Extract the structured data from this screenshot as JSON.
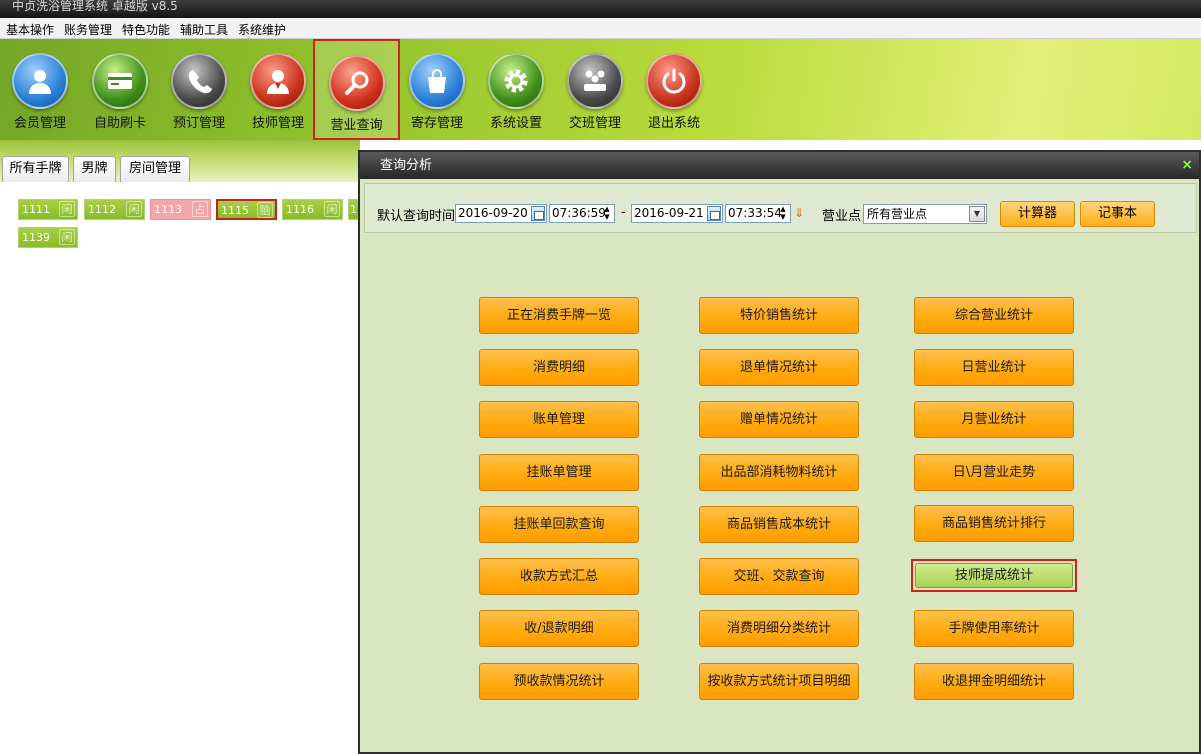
{
  "window": {
    "title": "中贞洗浴管理系统 卓越版 v8.5"
  },
  "menu": [
    "基本操作",
    "账务管理",
    "特色功能",
    "辅助工具",
    "系统维护"
  ],
  "toolbar": [
    {
      "label": "会员管理",
      "icon": "member-icon",
      "color": "#2a7fd6"
    },
    {
      "label": "自助刷卡",
      "icon": "card-icon",
      "color": "#3e8f1a"
    },
    {
      "label": "预订管理",
      "icon": "phone-icon",
      "color": "#4a4a4a"
    },
    {
      "label": "技师管理",
      "icon": "technician-icon",
      "color": "#c8321c"
    },
    {
      "label": "营业查询",
      "icon": "search-icon",
      "color": "#d0321c"
    },
    {
      "label": "寄存管理",
      "icon": "bag-icon",
      "color": "#2a7fd6"
    },
    {
      "label": "系统设置",
      "icon": "gear-icon",
      "color": "#3e8f1a"
    },
    {
      "label": "交班管理",
      "icon": "handover-icon",
      "color": "#4a4a4a"
    },
    {
      "label": "退出系统",
      "icon": "power-icon",
      "color": "#c8321c"
    }
  ],
  "tabs": [
    "所有手牌",
    "男牌",
    "房间管理"
  ],
  "rooms": [
    {
      "number": "1111",
      "badge": "闲",
      "status_color": "#92c22c"
    },
    {
      "number": "1112",
      "badge": "闲",
      "status_color": "#92c22c"
    },
    {
      "number": "1113",
      "badge": "占",
      "status_color": "#f2a6a8"
    },
    {
      "number": "1115",
      "badge": "脑",
      "status_color": "#92c22c"
    },
    {
      "number": "1116",
      "badge": "闲",
      "status_color": "#92c22c"
    },
    {
      "number": "1",
      "badge": "",
      "status_color": "#92c22c"
    },
    {
      "number": "1139",
      "badge": "闲",
      "status_color": "#92c22c"
    }
  ],
  "dialog": {
    "title": "查询分析",
    "close_label": "×",
    "query_time_label": "默认查询时间",
    "start_date": "2016-09-20",
    "start_time": "07:36:59",
    "separator": "-",
    "end_date": "2016-09-21",
    "end_time": "07:33:54",
    "outlet_label": "营业点",
    "outlet_value": "所有营业点",
    "calculator_label": "计算器",
    "notepad_label": "记事本",
    "buttons": [
      "正在消费手牌一览",
      "特价销售统计",
      "综合营业统计",
      "消费明细",
      "退单情况统计",
      "日营业统计",
      "账单管理",
      "赠单情况统计",
      "月营业统计",
      "挂账单管理",
      "出品部消耗物料统计",
      "日\\月营业走势",
      "挂账单回款查询",
      "商品销售成本统计",
      "商品销售统计排行",
      "收款方式汇总",
      "交班、交款查询",
      "技师提成统计",
      "收/退款明细",
      "消费明细分类统计",
      "手牌使用率统计",
      "预收款情况统计",
      "按收款方式统计项目明细",
      "收退押金明细统计"
    ]
  }
}
